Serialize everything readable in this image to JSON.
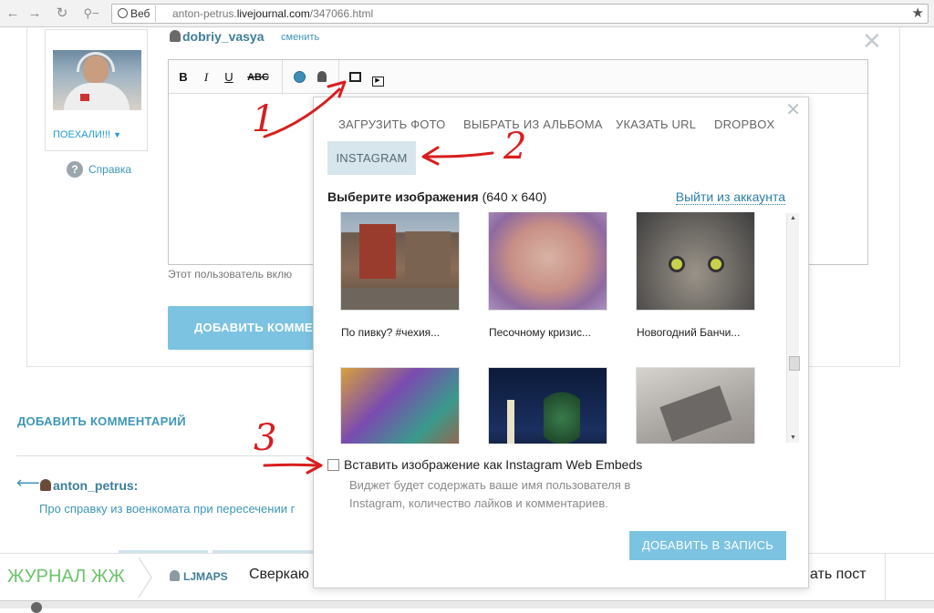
{
  "browser": {
    "search_chip": "Веб",
    "url_prefix": "anton-petrus.",
    "url_domain": "livejournal.com",
    "url_path": "/347066.html",
    "icons": [
      "back-icon",
      "forward-icon",
      "reload-icon",
      "key-icon",
      "globe-icon",
      "star-icon"
    ]
  },
  "comment_form": {
    "username": "dobriy_vasya",
    "change_label": "сменить",
    "userpic_caption": "ПОЕХАЛИ!!!",
    "help_label": "Справка",
    "toolbar": {
      "bold": "B",
      "italic": "I",
      "underline": "U",
      "strike": "ABC"
    },
    "note_text": "Этот пользователь вклю",
    "submit_label": "ДОБАВИТЬ КОММЕНТ"
  },
  "comments": {
    "add_comment_label": "ДОБАВИТЬ КОММЕНТАРИЙ",
    "author": "anton_petrus:",
    "post_title": "Про справку из военкомата при пересечении г"
  },
  "lj_bar": {
    "logo": "ЖУРНАЛ ЖЖ",
    "maps_label": "LJMAPS",
    "headline": "Сверкаю",
    "right_text": "ать пост"
  },
  "modal": {
    "tabs": [
      "ЗАГРУЗИТЬ ФОТО",
      "ВЫБРАТЬ ИЗ АЛЬБОМА",
      "УКАЗАТЬ URL",
      "DROPBOX"
    ],
    "active_tab": "INSTAGRAM",
    "select_title": "Выберите изображения",
    "select_size": "(640 x 640)",
    "logout_label": "Выйти из аккаунта",
    "images": [
      {
        "caption": "По пивку? #чехия..."
      },
      {
        "caption": "Песочному кризис..."
      },
      {
        "caption": "Новогодний Банчи..."
      },
      {
        "caption": ""
      },
      {
        "caption": ""
      },
      {
        "caption": ""
      }
    ],
    "embed_label": "Вставить изображение как Instagram Web Embeds",
    "embed_desc": "Виджет будет содержать ваше имя пользователя в Instagram, количество лайков и комментариев.",
    "submit_label": "ДОБАВИТЬ В ЗАПИСЬ"
  },
  "annotations": [
    "1",
    "2",
    "3"
  ],
  "colors": {
    "accent": "#7cc3e1",
    "link": "#3d96b8",
    "annotation": "#d81e1e",
    "lj_green": "#6cc36b"
  }
}
